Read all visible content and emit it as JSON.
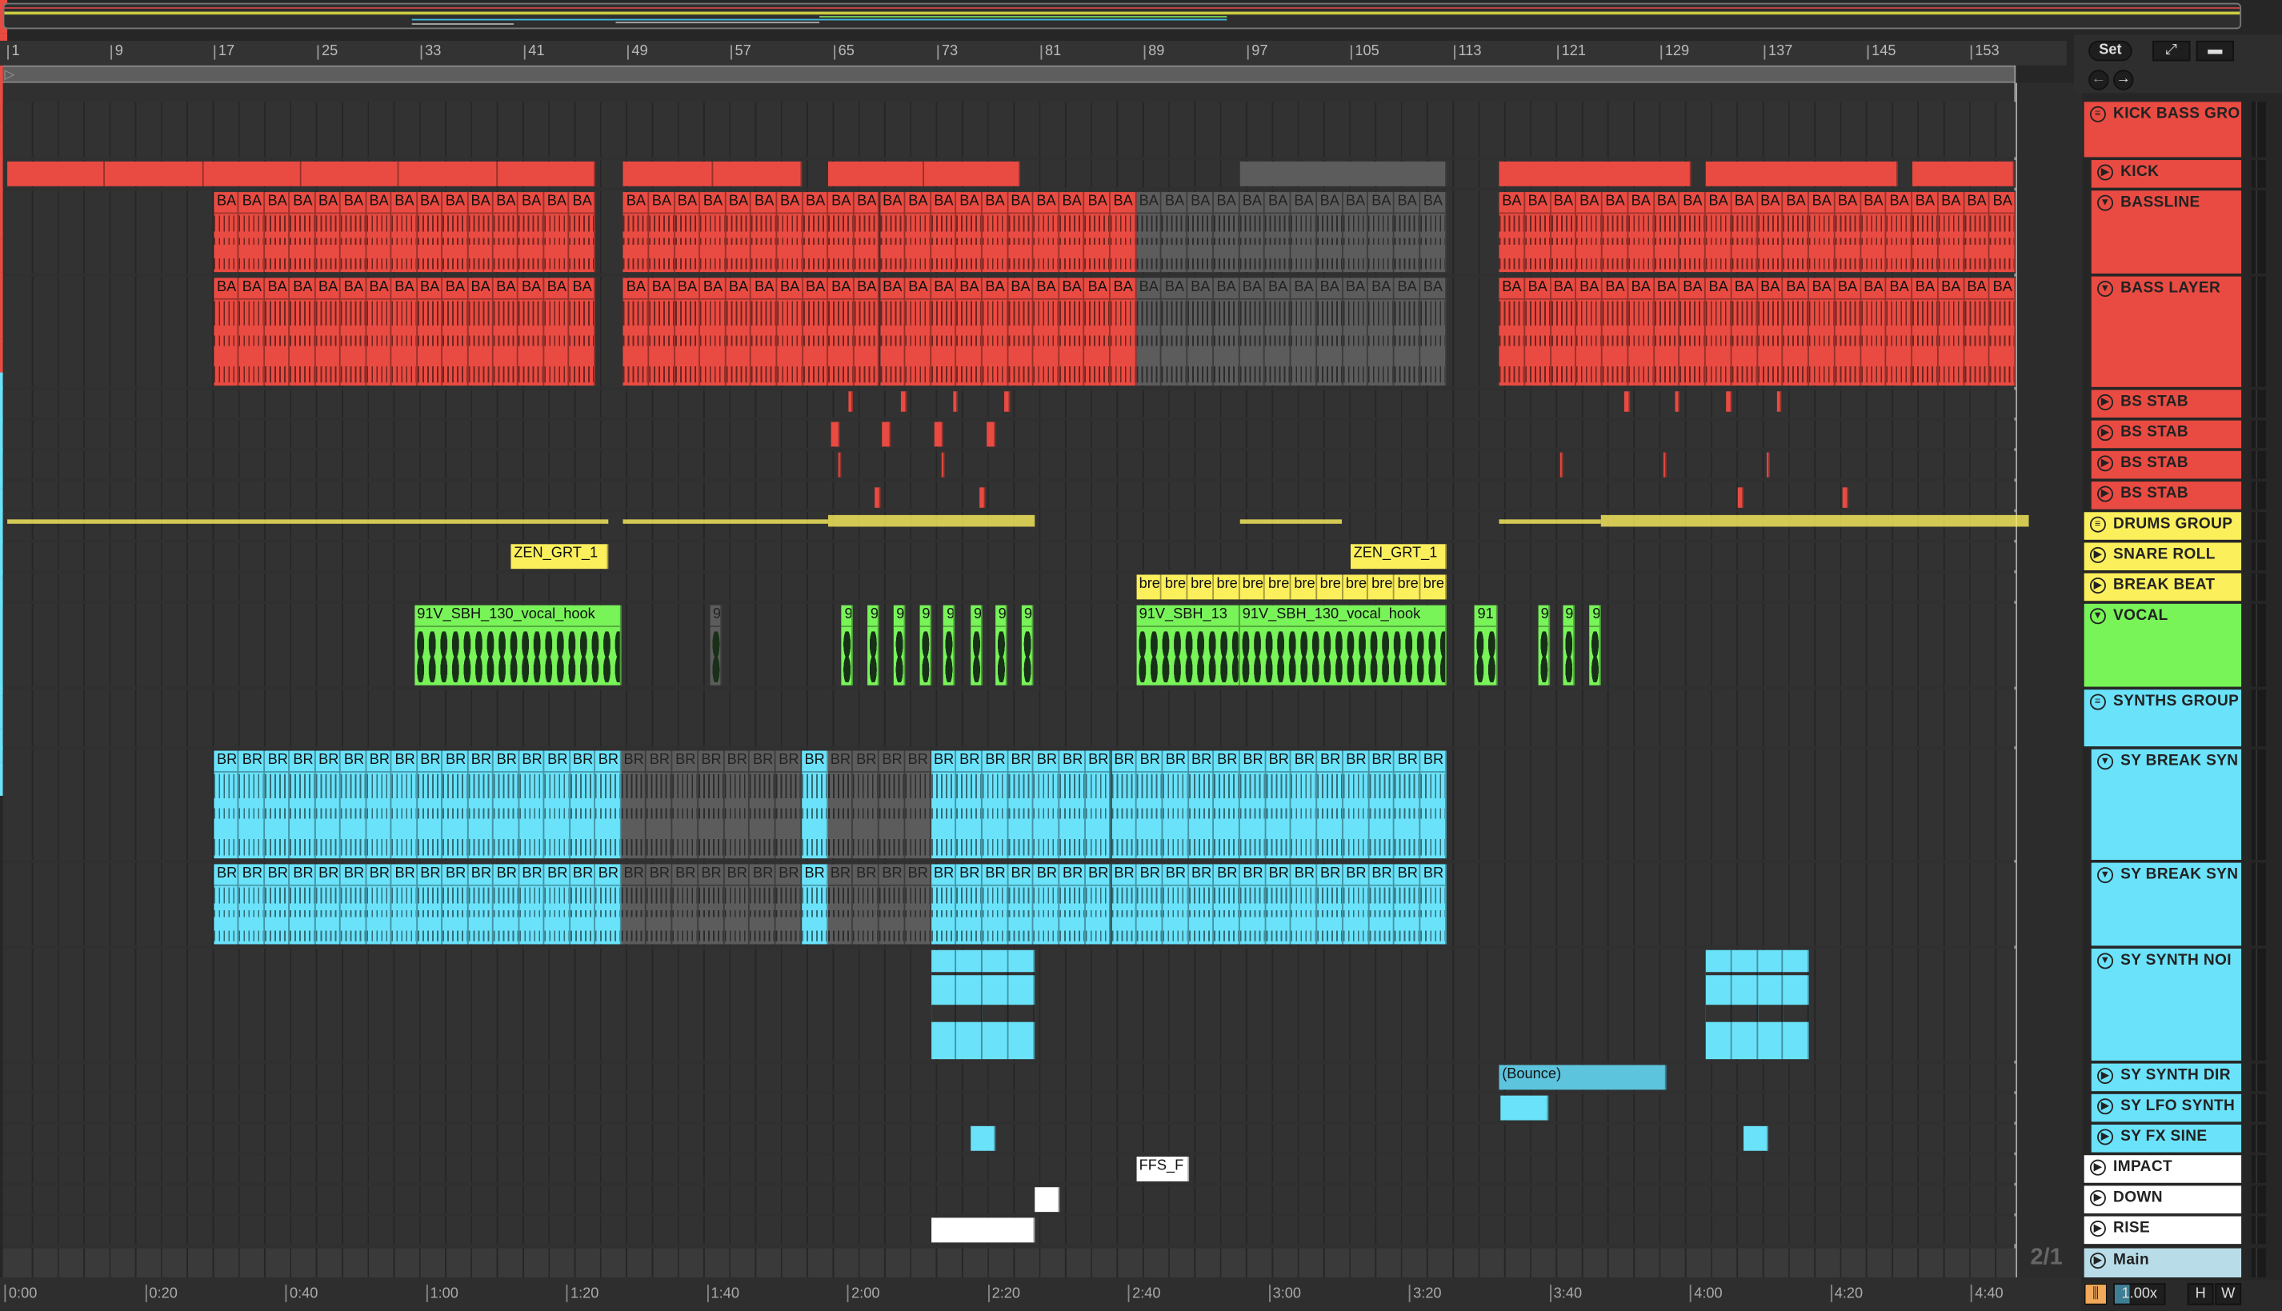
{
  "header_controls": {
    "set_label": "Set",
    "expand_icon": "expand-icon",
    "lock_icon": "lock-icon",
    "back_icon": "arrow-left-icon",
    "forward_icon": "arrow-right-icon"
  },
  "ruler": {
    "bars": [
      "1",
      "9",
      "17",
      "25",
      "33",
      "41",
      "49",
      "57",
      "65",
      "73",
      "81",
      "89",
      "97",
      "105",
      "113",
      "121",
      "129",
      "137",
      "145",
      "153"
    ]
  },
  "time_ruler": {
    "labels": [
      "0:00",
      "0:20",
      "0:40",
      "1:00",
      "1:20",
      "1:40",
      "2:00",
      "2:20",
      "2:40",
      "3:00",
      "3:20",
      "3:40",
      "4:00",
      "4:20",
      "4:40"
    ]
  },
  "time_signature": "2/1",
  "footer": {
    "zoom": "1.00x",
    "h_label": "H",
    "w_label": "W"
  },
  "colors": {
    "red": "#e94b42",
    "yellow": "#fbef5c",
    "green": "#78f459",
    "cyan": "#6ae2fa",
    "white": "#ffffff",
    "main": "#b9dde8",
    "muted": "#5c5c5c"
  },
  "tracks": [
    {
      "name": "KICK BASS GRO",
      "kind": "group",
      "color": "red",
      "clips": []
    },
    {
      "name": "KICK",
      "kind": "track",
      "child": true,
      "color": "red",
      "clips": [
        {
          "s": 1,
          "e": 46.5,
          "seg": 8
        },
        {
          "s": 48.7,
          "e": 62.5,
          "seg": 8
        },
        {
          "s": 64.5,
          "e": 79.4,
          "seg": 8
        },
        {
          "s": 96.4,
          "e": 112.4,
          "muted": true
        },
        {
          "s": 116.5,
          "e": 131.4
        },
        {
          "s": 132.5,
          "e": 147.4
        },
        {
          "s": 148.5,
          "e": 156.4
        }
      ]
    },
    {
      "name": "BASSLINE",
      "kind": "fold",
      "child": true,
      "color": "red",
      "clips": [
        {
          "s": 17,
          "e": 46.5,
          "label": "BA",
          "seg": 2,
          "style": "midi"
        },
        {
          "s": 48.7,
          "e": 88.4,
          "label": "BA",
          "seg": 2,
          "style": "midi"
        },
        {
          "s": 88.4,
          "e": 112.4,
          "label": "BA",
          "seg": 2,
          "style": "midi",
          "muted": true
        },
        {
          "s": 116.5,
          "e": 156.5,
          "label": "BA",
          "seg": 2,
          "style": "midi"
        }
      ]
    },
    {
      "name": "BASS LAYER",
      "kind": "fold",
      "child": true,
      "color": "red",
      "clips": [
        {
          "s": 17,
          "e": 46.5,
          "label": "BA",
          "seg": 2,
          "style": "midi"
        },
        {
          "s": 48.7,
          "e": 88.4,
          "label": "BA",
          "seg": 2,
          "style": "midi"
        },
        {
          "s": 88.4,
          "e": 112.4,
          "label": "BA",
          "seg": 2,
          "style": "midi",
          "muted": true
        },
        {
          "s": 116.5,
          "e": 156.5,
          "label": "BA",
          "seg": 2,
          "style": "midi"
        }
      ]
    },
    {
      "name": "BS STAB",
      "kind": "track",
      "child": true,
      "color": "red",
      "clips": [
        {
          "s": 66.1,
          "e": 66.5,
          "top": true
        },
        {
          "s": 70.2,
          "e": 70.6,
          "top": true
        },
        {
          "s": 74.2,
          "e": 74.6,
          "top": true
        },
        {
          "s": 78.2,
          "e": 78.6,
          "top": true
        },
        {
          "s": 126.2,
          "e": 126.6,
          "top": true
        },
        {
          "s": 130.1,
          "e": 130.5,
          "top": true
        },
        {
          "s": 134.1,
          "e": 134.5,
          "top": true
        },
        {
          "s": 138,
          "e": 138.4,
          "top": true
        }
      ]
    },
    {
      "name": "BS STAB",
      "kind": "track",
      "child": true,
      "color": "red",
      "clips": [
        {
          "s": 64.8,
          "e": 65.5
        },
        {
          "s": 68.7,
          "e": 69.4
        },
        {
          "s": 72.8,
          "e": 73.5
        },
        {
          "s": 76.8,
          "e": 77.5
        }
      ]
    },
    {
      "name": "BS STAB",
      "kind": "track",
      "child": true,
      "color": "red",
      "clips": [
        {
          "s": 65.3,
          "e": 65.6
        },
        {
          "s": 73.3,
          "e": 73.6
        },
        {
          "s": 121.2,
          "e": 121.5
        },
        {
          "s": 129.2,
          "e": 129.5
        },
        {
          "s": 137.2,
          "e": 137.5
        }
      ]
    },
    {
      "name": "BS STAB",
      "kind": "track",
      "child": true,
      "color": "red",
      "clips": [
        {
          "s": 68.2,
          "e": 68.6,
          "bottom": true
        },
        {
          "s": 76.3,
          "e": 76.7,
          "bottom": true
        },
        {
          "s": 135,
          "e": 135.4,
          "bottom": true
        },
        {
          "s": 143.1,
          "e": 143.5,
          "bottom": true
        }
      ]
    },
    {
      "name": "DRUMS GROUP",
      "kind": "group",
      "color": "yellow",
      "clips": [
        {
          "s": 1,
          "e": 47.5,
          "style": "line"
        },
        {
          "s": 48.7,
          "e": 64.5,
          "style": "line"
        },
        {
          "s": 64.5,
          "e": 80.5,
          "style": "thick"
        },
        {
          "s": 96.4,
          "e": 104.3,
          "style": "line"
        },
        {
          "s": 116.5,
          "e": 124.4,
          "style": "line"
        },
        {
          "s": 124.4,
          "e": 157.5,
          "style": "thick"
        }
      ]
    },
    {
      "name": "SNARE ROLL",
      "kind": "track",
      "color": "yellow",
      "clips": [
        {
          "s": 40,
          "e": 47.5,
          "label": "ZEN_GRT_1"
        },
        {
          "s": 105,
          "e": 112.4,
          "label": "ZEN_GRT_1"
        }
      ]
    },
    {
      "name": "BREAK BEAT",
      "kind": "track",
      "color": "yellow",
      "clips": [
        {
          "s": 88.4,
          "e": 112.4,
          "label": "bre",
          "seg": 2
        }
      ]
    },
    {
      "name": "VOCAL",
      "kind": "fold",
      "color": "green",
      "clips": [
        {
          "s": 32.5,
          "e": 48.5,
          "label": "91V_SBH_130_vocal_hook",
          "style": "audio"
        },
        {
          "s": 55.4,
          "e": 56.3,
          "label": "9",
          "style": "audio",
          "muted": true
        },
        {
          "s": 65.6,
          "e": 66.5,
          "label": "9",
          "style": "audio"
        },
        {
          "s": 67.6,
          "e": 68.5,
          "label": "9",
          "style": "audio"
        },
        {
          "s": 69.6,
          "e": 70.5,
          "label": "9",
          "style": "audio"
        },
        {
          "s": 71.6,
          "e": 72.5,
          "label": "9",
          "style": "audio"
        },
        {
          "s": 73.5,
          "e": 74.4,
          "label": "9",
          "style": "audio"
        },
        {
          "s": 75.6,
          "e": 76.5,
          "label": "9",
          "style": "audio"
        },
        {
          "s": 77.5,
          "e": 78.4,
          "label": "9",
          "style": "audio"
        },
        {
          "s": 79.5,
          "e": 80.4,
          "label": "9",
          "style": "audio"
        },
        {
          "s": 88.4,
          "e": 96.4,
          "label": "91V_SBH_13",
          "style": "audio"
        },
        {
          "s": 96.4,
          "e": 112.4,
          "label": "91V_SBH_130_vocal_hook",
          "style": "audio"
        },
        {
          "s": 114.6,
          "e": 116.4,
          "label": "91",
          "style": "audio"
        },
        {
          "s": 119.5,
          "e": 120.4,
          "label": "9",
          "style": "audio"
        },
        {
          "s": 121.4,
          "e": 122.3,
          "label": "9",
          "style": "audio"
        },
        {
          "s": 123.5,
          "e": 124.4,
          "label": "9",
          "style": "audio"
        }
      ]
    },
    {
      "name": "SYNTHS GROUP",
      "kind": "group",
      "color": "cyan",
      "clips": []
    },
    {
      "name": "SY BREAK SYN",
      "kind": "fold",
      "child": true,
      "color": "cyan",
      "clips": [
        {
          "s": 17,
          "e": 48.5,
          "label": "BR",
          "seg": 2,
          "style": "midi"
        },
        {
          "s": 48.5,
          "e": 62.5,
          "label": "BR",
          "seg": 2,
          "style": "midi",
          "muted": true
        },
        {
          "s": 62.5,
          "e": 64.5,
          "label": "BR",
          "seg": 2,
          "style": "midi"
        },
        {
          "s": 64.5,
          "e": 72.5,
          "label": "BR",
          "seg": 2,
          "style": "midi",
          "muted": true
        },
        {
          "s": 72.5,
          "e": 112.4,
          "label": "BR",
          "seg": 2,
          "style": "midi"
        }
      ]
    },
    {
      "name": "SY BREAK SYN",
      "kind": "fold",
      "child": true,
      "color": "cyan",
      "clips": [
        {
          "s": 17,
          "e": 48.5,
          "label": "BR",
          "seg": 2,
          "style": "midi"
        },
        {
          "s": 48.5,
          "e": 62.5,
          "label": "BR",
          "seg": 2,
          "style": "midi",
          "muted": true
        },
        {
          "s": 62.5,
          "e": 64.5,
          "label": "BR",
          "seg": 2,
          "style": "midi"
        },
        {
          "s": 64.5,
          "e": 72.5,
          "label": "BR",
          "seg": 2,
          "style": "midi",
          "muted": true
        },
        {
          "s": 72.5,
          "e": 112.4,
          "label": "BR",
          "seg": 2,
          "style": "midi"
        }
      ]
    },
    {
      "name": "SY SYNTH NOI",
      "kind": "fold",
      "child": true,
      "color": "cyan",
      "clips": [
        {
          "s": 72.5,
          "e": 80.5,
          "seg": 2,
          "style": "blocks"
        },
        {
          "s": 132.5,
          "e": 140.5,
          "seg": 2,
          "style": "blocks"
        }
      ]
    },
    {
      "name": "SY SYNTH DIR",
      "kind": "track",
      "child": true,
      "color": "cyan",
      "clips": [
        {
          "s": 116.5,
          "e": 129.5,
          "label": "(Bounce)",
          "dim": true
        }
      ]
    },
    {
      "name": "SY LFO SYNTH",
      "kind": "track",
      "child": true,
      "color": "cyan",
      "clips": [
        {
          "s": 116.6,
          "e": 120.3
        }
      ]
    },
    {
      "name": "SY FX SINE",
      "kind": "track",
      "child": true,
      "color": "cyan",
      "clips": [
        {
          "s": 75.6,
          "e": 77.5
        },
        {
          "s": 135.4,
          "e": 137.3
        }
      ]
    },
    {
      "name": "IMPACT",
      "kind": "track",
      "color": "white",
      "clips": [
        {
          "s": 88.4,
          "e": 92.5,
          "label": "FFS_F"
        }
      ]
    },
    {
      "name": "DOWN",
      "kind": "track",
      "color": "white",
      "clips": [
        {
          "s": 80.5,
          "e": 82.5
        }
      ]
    },
    {
      "name": "RISE",
      "kind": "track",
      "color": "white",
      "clips": [
        {
          "s": 72.5,
          "e": 80.5
        }
      ]
    },
    {
      "name": "Main",
      "kind": "main",
      "color": "main",
      "clips": []
    }
  ]
}
